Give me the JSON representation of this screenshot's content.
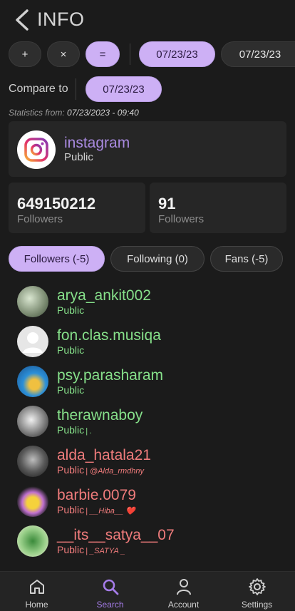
{
  "header": {
    "title": "INFO"
  },
  "toolbar": {
    "plus": "+",
    "times": "×",
    "equals": "=",
    "date1": "07/23/23",
    "date2": "07/23/23"
  },
  "compare": {
    "label": "Compare to",
    "date": "07/23/23"
  },
  "stats_from": {
    "label": "Statistics from:",
    "value": "07/23/2023 - 09:40"
  },
  "profile": {
    "name": "instagram",
    "status": "Public"
  },
  "stats": [
    {
      "value": "649150212",
      "label": "Followers"
    },
    {
      "value": "91",
      "label": "Followers"
    }
  ],
  "tabs": [
    {
      "label": "Followers (-5)"
    },
    {
      "label": "Following (0)"
    },
    {
      "label": "Fans (-5)"
    }
  ],
  "users": [
    {
      "name": "arya_ankit002",
      "status": "Public",
      "bio": ""
    },
    {
      "name": "fon.clas.musiqa",
      "status": "Public",
      "bio": ""
    },
    {
      "name": "psy.parasharam",
      "status": "Public",
      "bio": ""
    },
    {
      "name": "therawnaboy",
      "status": "Public",
      "bio": "| ."
    },
    {
      "name": "alda_hatala21",
      "status": "Public",
      "bio": "| @Alda_rmdhny"
    },
    {
      "name": "barbie.0079",
      "status": "Public",
      "bio": "| __Hiba__ ❤️"
    },
    {
      "name": "__its__satya__07",
      "status": "Public",
      "bio": "| _SATYA _"
    }
  ],
  "nav": [
    {
      "label": "Home"
    },
    {
      "label": "Search"
    },
    {
      "label": "Account"
    },
    {
      "label": "Settings"
    }
  ],
  "colors": {
    "accent": "#cdb0f5",
    "nav_active": "#a57ce8",
    "green": "#86e08a",
    "red": "#f07c7c",
    "background": "#1b1b1b"
  }
}
